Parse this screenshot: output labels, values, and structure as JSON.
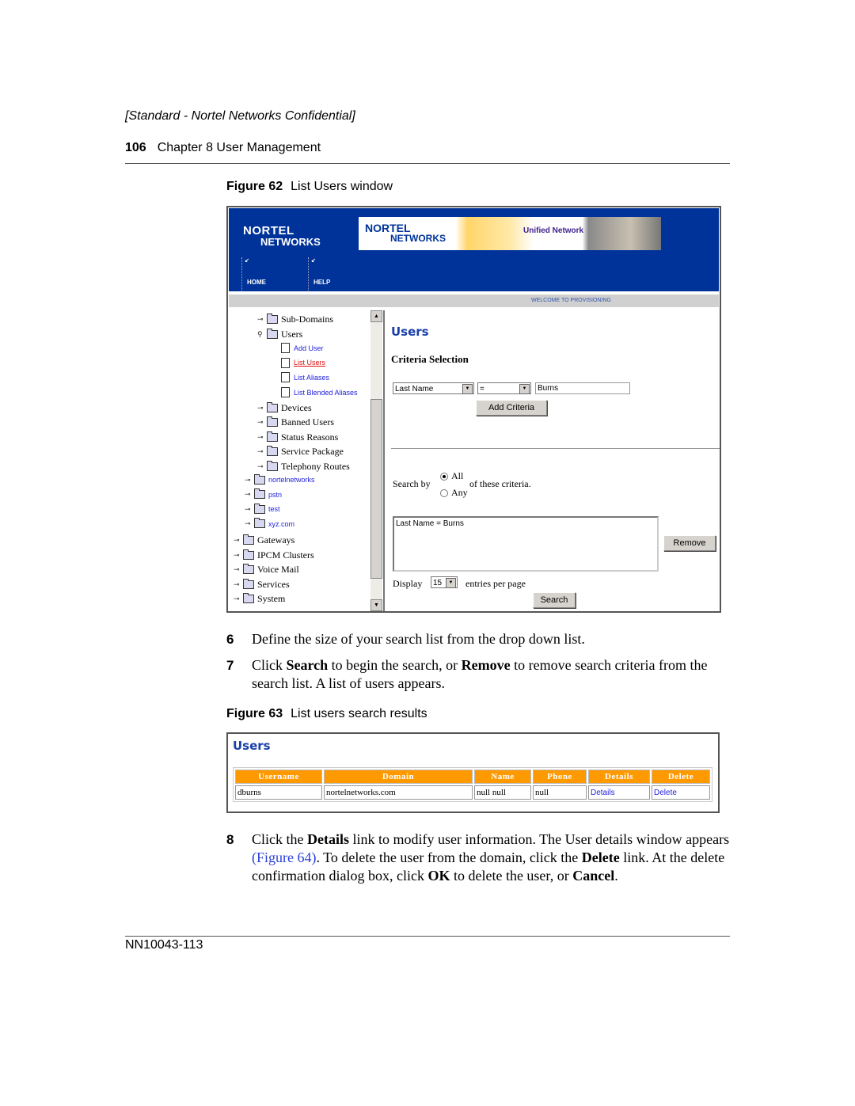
{
  "header": {
    "confidential": "[Standard - Nortel Networks Confidential]",
    "page_number": "106",
    "chapter": "Chapter 8  User Management"
  },
  "figure62": {
    "label": "Figure 62",
    "caption": "List Users window",
    "banner": {
      "logo_line1": "NORTEL",
      "logo_line2": "NETWORKS",
      "image_logo_line1": "NORTEL",
      "image_logo_line2": "NETWORKS",
      "image_tagline": "Unified Network",
      "nav": [
        "HOME",
        "HELP"
      ],
      "welcome": "WELCOME TO PROVISIONING"
    },
    "tree": [
      {
        "label": "Sub-Domains",
        "level": 2,
        "type": "folder",
        "state": "collapsed"
      },
      {
        "label": "Users",
        "level": 2,
        "type": "folder",
        "state": "expanded"
      },
      {
        "label": "Add User",
        "level": 3,
        "type": "link"
      },
      {
        "label": "List Users",
        "level": 3,
        "type": "link",
        "active": true
      },
      {
        "label": "List Aliases",
        "level": 3,
        "type": "link"
      },
      {
        "label": "List Blended Aliases",
        "level": 3,
        "type": "link"
      },
      {
        "label": "Devices",
        "level": 2,
        "type": "folder",
        "state": "collapsed"
      },
      {
        "label": "Banned Users",
        "level": 2,
        "type": "folder",
        "state": "collapsed"
      },
      {
        "label": "Status Reasons",
        "level": 2,
        "type": "folder",
        "state": "collapsed"
      },
      {
        "label": "Service Package",
        "level": 2,
        "type": "folder",
        "state": "collapsed"
      },
      {
        "label": "Telephony Routes",
        "level": 2,
        "type": "folder",
        "state": "collapsed"
      },
      {
        "label": "nortelnetworks",
        "level": 1,
        "type": "domain",
        "state": "collapsed"
      },
      {
        "label": "pstn",
        "level": 1,
        "type": "domain",
        "state": "collapsed"
      },
      {
        "label": "test",
        "level": 1,
        "type": "domain",
        "state": "collapsed"
      },
      {
        "label": "xyz.com",
        "level": 1,
        "type": "domain",
        "state": "collapsed"
      },
      {
        "label": "Gateways",
        "level": 0,
        "type": "folder",
        "state": "collapsed"
      },
      {
        "label": "IPCM Clusters",
        "level": 0,
        "type": "folder",
        "state": "collapsed"
      },
      {
        "label": "Voice Mail",
        "level": 0,
        "type": "folder",
        "state": "collapsed"
      },
      {
        "label": "Services",
        "level": 0,
        "type": "folder",
        "state": "collapsed"
      },
      {
        "label": "System",
        "level": 0,
        "type": "folder",
        "state": "collapsed"
      }
    ],
    "main": {
      "title": "Users",
      "criteria_heading": "Criteria Selection",
      "field_select": "Last Name",
      "operator_select": "=",
      "value_input": "Burns",
      "add_criteria_button": "Add Criteria",
      "search_by_label": "Search by",
      "radio_all": "All",
      "radio_any": "Any",
      "radio_selected": "All",
      "criteria_suffix": "of these criteria.",
      "criteria_list": [
        "Last Name = Burns"
      ],
      "remove_button": "Remove",
      "display_label": "Display",
      "display_select": "15",
      "entries_label": "entries per page",
      "search_button": "Search"
    }
  },
  "steps": [
    {
      "num": "6",
      "parts": [
        {
          "t": "Define the size of your search list from the drop down list."
        }
      ]
    },
    {
      "num": "7",
      "parts": [
        {
          "t": "Click "
        },
        {
          "b": "Search"
        },
        {
          "t": " to begin the search, or "
        },
        {
          "b": "Remove"
        },
        {
          "t": " to remove search criteria from the search list. A list of users appears."
        }
      ]
    },
    {
      "num": "8",
      "parts": [
        {
          "t": "Click the "
        },
        {
          "b": "Details"
        },
        {
          "t": " link to modify user information. The User details window appears "
        },
        {
          "x": "(Figure 64)"
        },
        {
          "t": ". To delete the user from the domain, click the "
        },
        {
          "b": "Delete"
        },
        {
          "t": " link. At the delete confirmation dialog box, click "
        },
        {
          "b": "OK"
        },
        {
          "t": " to delete the user, or "
        },
        {
          "b": "Cancel"
        },
        {
          "t": "."
        }
      ]
    }
  ],
  "figure63": {
    "label": "Figure 63",
    "caption": "List users search results",
    "title": "Users",
    "columns": [
      "Username",
      "Domain",
      "Name",
      "Phone",
      "Details",
      "Delete"
    ],
    "rows": [
      [
        "dburns",
        "nortelnetworks.com",
        "null null",
        "null",
        "Details",
        "Delete"
      ]
    ],
    "header_color": "#ff9900"
  },
  "footer": {
    "doc_number": "NN10043-113"
  },
  "colors": {
    "banner_blue": "#003399",
    "link_blue": "#2222dd",
    "active_link_red": "#e01010",
    "title_blue": "#1a3fa8"
  }
}
